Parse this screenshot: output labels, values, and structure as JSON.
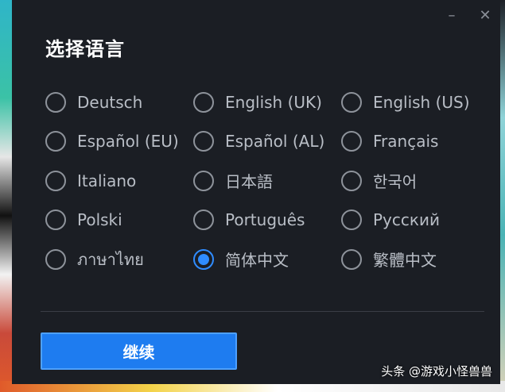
{
  "dialog": {
    "title": "选择语言",
    "window_controls": {
      "minimize_icon": "minimize-icon",
      "close_icon": "close-icon"
    },
    "languages": [
      {
        "label": "Deutsch",
        "selected": false
      },
      {
        "label": "English (UK)",
        "selected": false
      },
      {
        "label": "English (US)",
        "selected": false
      },
      {
        "label": "Español (EU)",
        "selected": false
      },
      {
        "label": "Español (AL)",
        "selected": false
      },
      {
        "label": "Français",
        "selected": false
      },
      {
        "label": "Italiano",
        "selected": false
      },
      {
        "label": "日本語",
        "selected": false
      },
      {
        "label": "한국어",
        "selected": false
      },
      {
        "label": "Polski",
        "selected": false
      },
      {
        "label": "Português",
        "selected": false
      },
      {
        "label": "Русский",
        "selected": false
      },
      {
        "label": "ภาษาไทย",
        "selected": false
      },
      {
        "label": "简体中文",
        "selected": true
      },
      {
        "label": "繁體中文",
        "selected": false
      }
    ],
    "continue_label": "继续"
  },
  "watermark": "头条 @游戏小怪兽兽",
  "colors": {
    "background": "#1b1e24",
    "accent": "#1e7cf0",
    "radio_selected": "#2f8cff",
    "text_primary": "#ffffff",
    "text_secondary": "#b9bec6"
  }
}
